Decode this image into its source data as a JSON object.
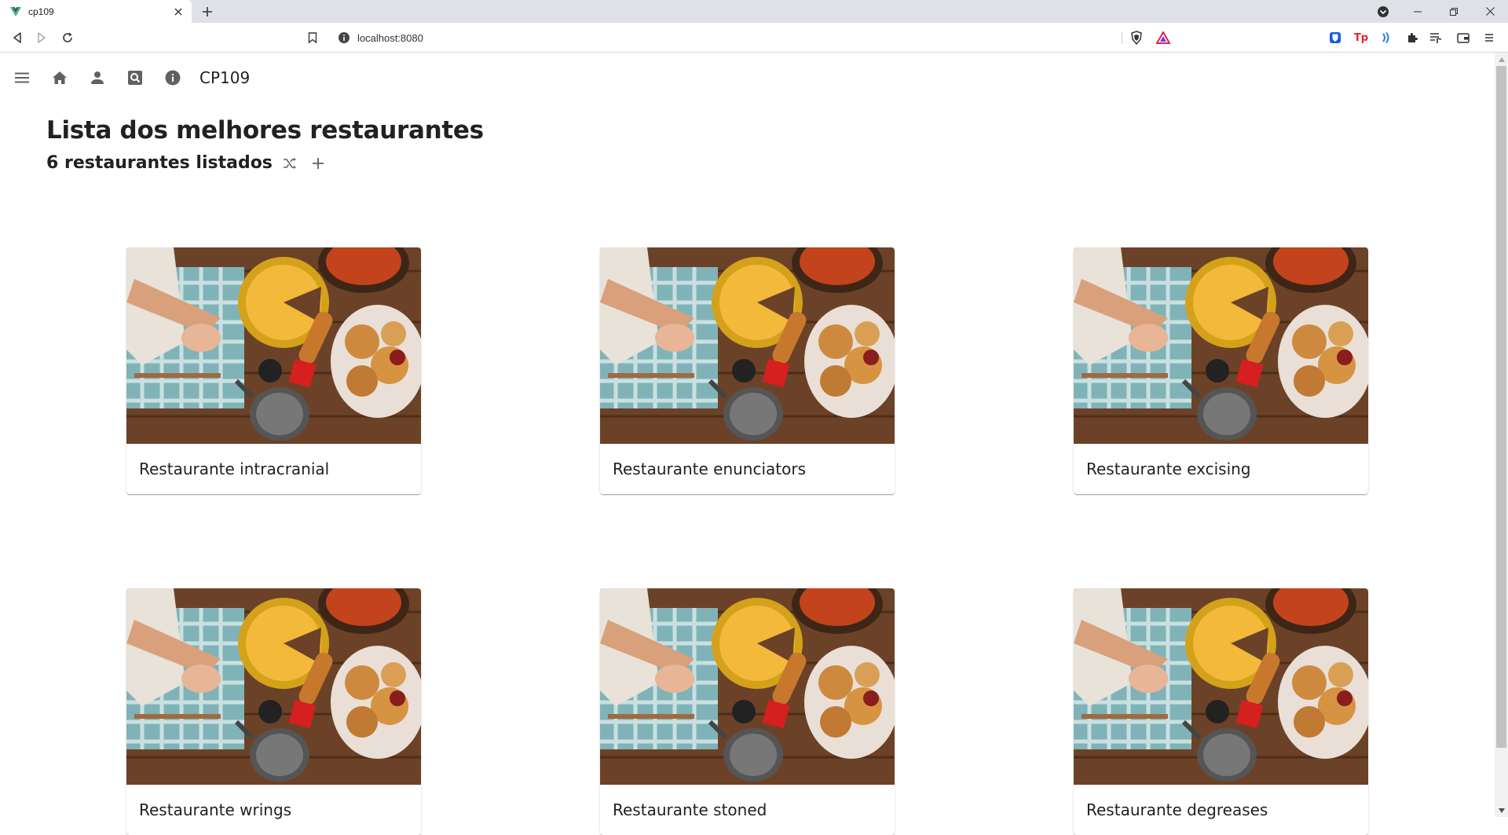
{
  "browser": {
    "tab_title": "cp109",
    "url": "localhost:8080"
  },
  "app": {
    "title": "CP109",
    "nav_icons": [
      "menu-icon",
      "home-icon",
      "person-icon",
      "search-icon",
      "info-icon"
    ]
  },
  "page": {
    "title": "Lista dos melhores restaurantes",
    "subtitle": "6 restaurantes listados"
  },
  "restaurants": [
    {
      "name": "Restaurante intracranial"
    },
    {
      "name": "Restaurante enunciators"
    },
    {
      "name": "Restaurante excising"
    },
    {
      "name": "Restaurante wrings"
    },
    {
      "name": "Restaurante stoned"
    },
    {
      "name": "Restaurante degreases"
    }
  ],
  "colors": {
    "vue_green": "#41b883",
    "vue_dark": "#35495e",
    "text": "#212121",
    "icon": "#616161"
  }
}
